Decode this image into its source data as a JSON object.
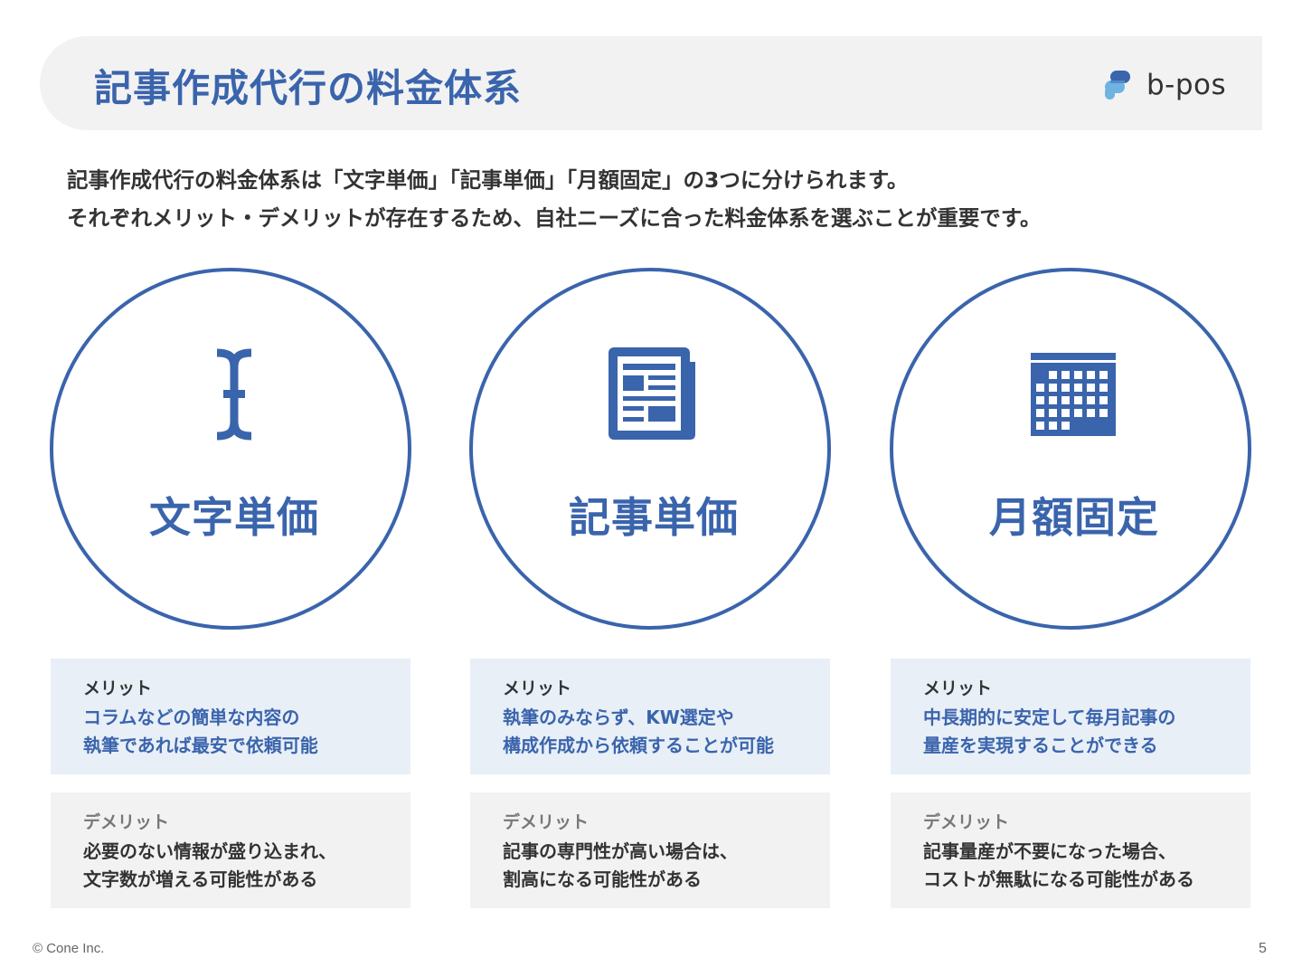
{
  "header": {
    "title": "記事作成代行の料金体系",
    "logo_text": "b-pos"
  },
  "intro": {
    "line1": "記事作成代行の料金体系は「文字単価」「記事単価」「月額固定」の3つに分けられます。",
    "line2": "それぞれメリット・デメリットが存在するため、自社ニーズに合った料金体系を選ぶことが重要です。"
  },
  "columns": [
    {
      "icon": "text-cursor-icon",
      "label": "文字単価",
      "merit": {
        "heading": "メリット",
        "lines": [
          "コラムなどの簡単な内容の",
          "執筆であれば最安で依頼可能"
        ]
      },
      "demerit": {
        "heading": "デメリット",
        "lines": [
          "必要のない情報が盛り込まれ、",
          "文字数が増える可能性がある"
        ]
      }
    },
    {
      "icon": "newspaper-icon",
      "label": "記事単価",
      "merit": {
        "heading": "メリット",
        "lines": [
          "執筆のみならず、KW選定や",
          "構成作成から依頼することが可能"
        ]
      },
      "demerit": {
        "heading": "デメリット",
        "lines": [
          "記事の専門性が高い場合は、",
          "割高になる可能性がある"
        ]
      }
    },
    {
      "icon": "calendar-icon",
      "label": "月額固定",
      "merit": {
        "heading": "メリット",
        "lines": [
          "中長期的に安定して毎月記事の",
          "量産を実現することができる"
        ]
      },
      "demerit": {
        "heading": "デメリット",
        "lines": [
          "記事量産が不要になった場合、",
          "コストが無駄になる可能性がある"
        ]
      }
    }
  ],
  "footer": {
    "copyright": "© Cone Inc.",
    "page_number": "5"
  },
  "colors": {
    "accent": "#3a64ac",
    "merit_bg": "#e8eff7",
    "demerit_bg": "#f2f2f2",
    "header_bg": "#f2f2f2",
    "logo_dark": "#3a64ac",
    "logo_light": "#6fb3e0"
  }
}
